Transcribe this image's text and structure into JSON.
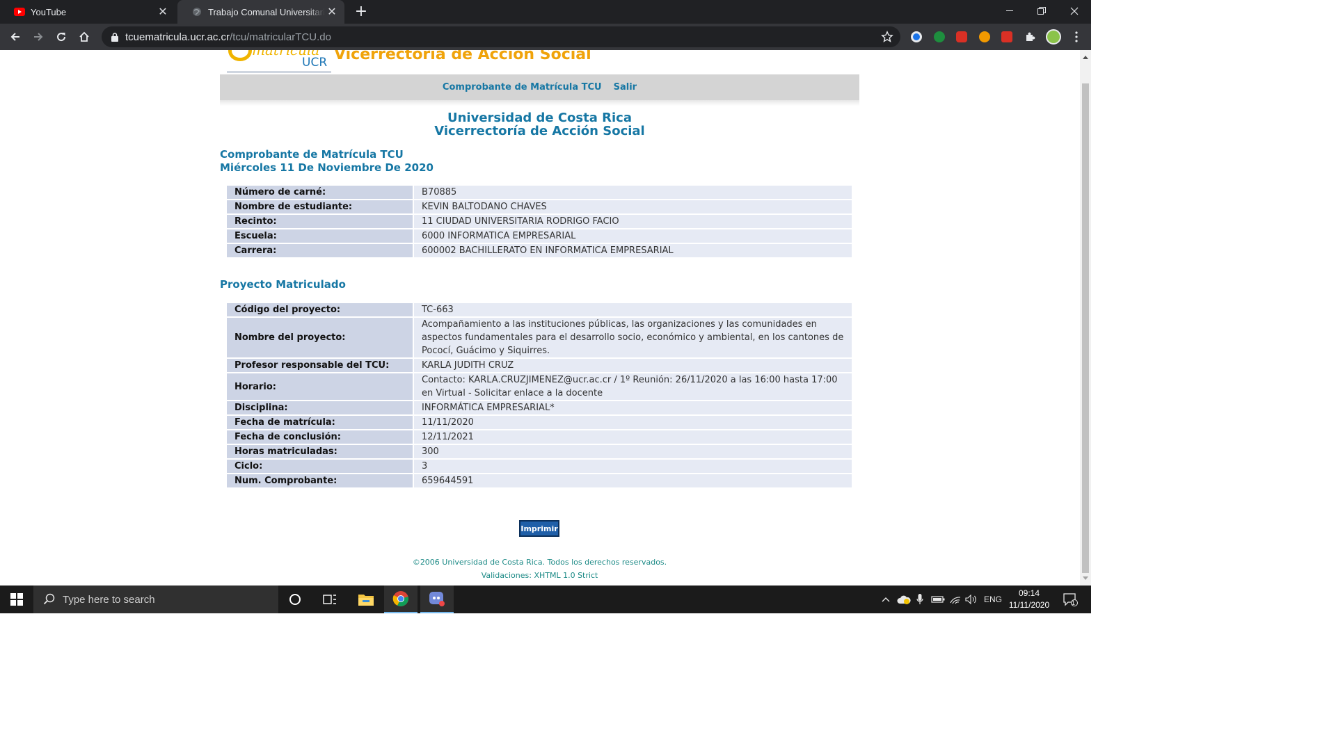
{
  "browser": {
    "tabs": [
      {
        "title": "YouTube",
        "favicon": "youtube-icon"
      },
      {
        "title": "Trabajo Comunal Universitario - C",
        "favicon": "globe-icon",
        "active": true
      }
    ],
    "url_host": "tcuematricula.ucr.ac.cr",
    "url_path": "/tcu/matricularTCU.do"
  },
  "site": {
    "logo_script": "matrícula",
    "logo_ucr": "UCR",
    "header_title": "Vicerrectoría de Acción Social",
    "menu": [
      "Comprobante de Matrícula TCU",
      "Salir"
    ],
    "university": "Universidad de Costa Rica",
    "vicerrectoria": "Vicerrectoría de Acción Social",
    "receipt_title": "Comprobante de Matrícula TCU",
    "receipt_date": "Miércoles 11 De Noviembre De 2020",
    "student_rows": [
      {
        "label": "Número de carné:",
        "value": "B70885"
      },
      {
        "label": "Nombre de estudiante:",
        "value": "KEVIN BALTODANO CHAVES"
      },
      {
        "label": "Recinto:",
        "value": "11 CIUDAD UNIVERSITARIA RODRIGO FACIO"
      },
      {
        "label": "Escuela:",
        "value": "6000 INFORMATICA EMPRESARIAL"
      },
      {
        "label": "Carrera:",
        "value": "600002 BACHILLERATO EN INFORMATICA EMPRESARIAL"
      }
    ],
    "project_title": "Proyecto Matriculado",
    "project_rows": [
      {
        "label": "Código del proyecto:",
        "value": "TC-663"
      },
      {
        "label": "Nombre del proyecto:",
        "value": "Acompañamiento a las instituciones públicas, las organizaciones y las comunidades en aspectos fundamentales para el desarrollo socio, económico y ambiental, en los cantones de Pococí, Guácimo y Siquirres."
      },
      {
        "label": "Profesor responsable del TCU:",
        "value": "KARLA JUDITH CRUZ"
      },
      {
        "label": "Horario:",
        "value": "Contacto: KARLA.CRUZJIMENEZ@ucr.ac.cr / 1º Reunión: 26/11/2020 a las 16:00 hasta 17:00 en Virtual - Solicitar enlace a la docente"
      },
      {
        "label": "Disciplina:",
        "value": "INFORMÁTICA EMPRESARIAL*"
      },
      {
        "label": "Fecha de matrícula:",
        "value": "11/11/2020"
      },
      {
        "label": "Fecha de conclusión:",
        "value": "12/11/2021"
      },
      {
        "label": "Horas matriculadas:",
        "value": "300"
      },
      {
        "label": "Ciclo:",
        "value": "3"
      },
      {
        "label": "Num. Comprobante:",
        "value": "659644591"
      }
    ],
    "print_label": "Imprimir",
    "footer_copyright": "©2006 Universidad de Costa Rica. Todos los derechos reservados.",
    "footer_validation": "Validaciones: XHTML 1.0 Strict"
  },
  "taskbar": {
    "search_placeholder": "Type here to search",
    "language": "ENG",
    "time": "09:14",
    "date": "11/11/2020",
    "notification_count": "1"
  },
  "colors": {
    "accent_blue": "#1677a4",
    "header_orange": "#f0a30a",
    "label_bg": "#cdd4e5",
    "value_bg": "#e6eaf4"
  }
}
